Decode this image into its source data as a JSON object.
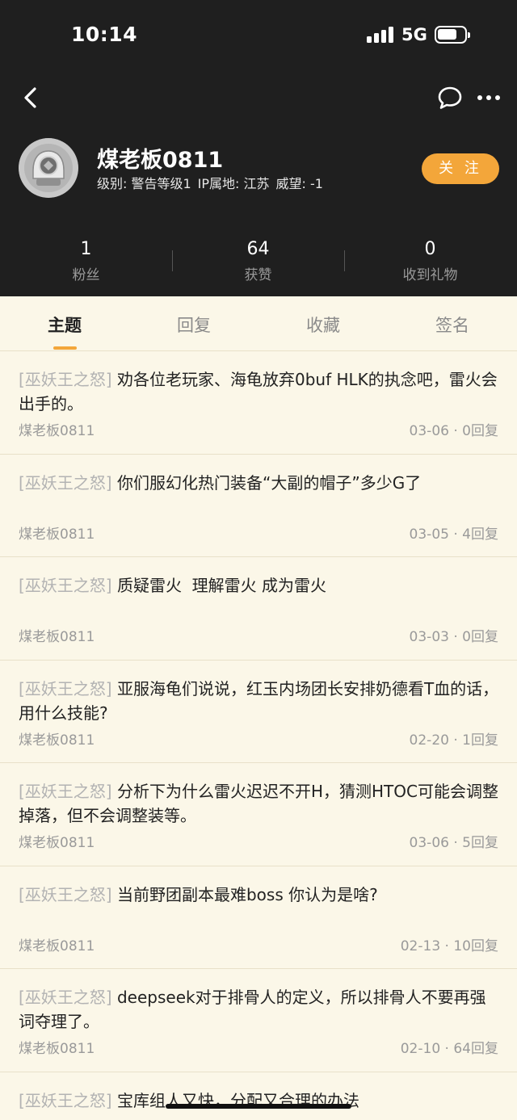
{
  "status": {
    "time": "10:14",
    "network": "5G"
  },
  "profile": {
    "username": "煤老板0811",
    "level": "级别: 警告等级1",
    "ip": "IP属地: 江苏",
    "prestige": "威望: -1",
    "follow_label": "关 注"
  },
  "stats": [
    {
      "value": "1",
      "label": "粉丝"
    },
    {
      "value": "64",
      "label": "获赞"
    },
    {
      "value": "0",
      "label": "收到礼物"
    }
  ],
  "tabs": [
    {
      "label": "主题",
      "active": true
    },
    {
      "label": "回复",
      "active": false
    },
    {
      "label": "收藏",
      "active": false
    },
    {
      "label": "签名",
      "active": false
    }
  ],
  "posts": [
    {
      "tag": "[巫妖王之怒]",
      "title": "劝各位老玩家、海龟放弃0buf HLK的执念吧，雷火会出手的。",
      "author": "煤老板0811",
      "date": "03-06",
      "replies": "0回复"
    },
    {
      "tag": "[巫妖王之怒]",
      "title": "你们服幻化热门装备“大副的帽子”多少G了",
      "author": "煤老板0811",
      "date": "03-05",
      "replies": "4回复"
    },
    {
      "tag": "[巫妖王之怒]",
      "title": "质疑雷火  理解雷火 成为雷火",
      "author": "煤老板0811",
      "date": "03-03",
      "replies": "0回复"
    },
    {
      "tag": "[巫妖王之怒]",
      "title": "亚服海龟们说说，红玉内场团长安排奶德看T血的话，用什么技能?",
      "author": "煤老板0811",
      "date": "02-20",
      "replies": "1回复"
    },
    {
      "tag": "[巫妖王之怒]",
      "title": "分析下为什么雷火迟迟不开H，猜测HTOC可能会调整掉落，但不会调整装等。",
      "author": "煤老板0811",
      "date": "03-06",
      "replies": "5回复"
    },
    {
      "tag": "[巫妖王之怒]",
      "title": "当前野团副本最难boss 你认为是啥?",
      "author": "煤老板0811",
      "date": "02-13",
      "replies": "10回复"
    },
    {
      "tag": "[巫妖王之怒]",
      "title": "deepseek对于排骨人的定义，所以排骨人不要再强词夺理了。",
      "author": "煤老板0811",
      "date": "02-10",
      "replies": "64回复"
    },
    {
      "tag": "[巫妖王之怒]",
      "title": "宝库组人又快，分配又合理的办法",
      "author": "",
      "date": "",
      "replies": ""
    }
  ]
}
